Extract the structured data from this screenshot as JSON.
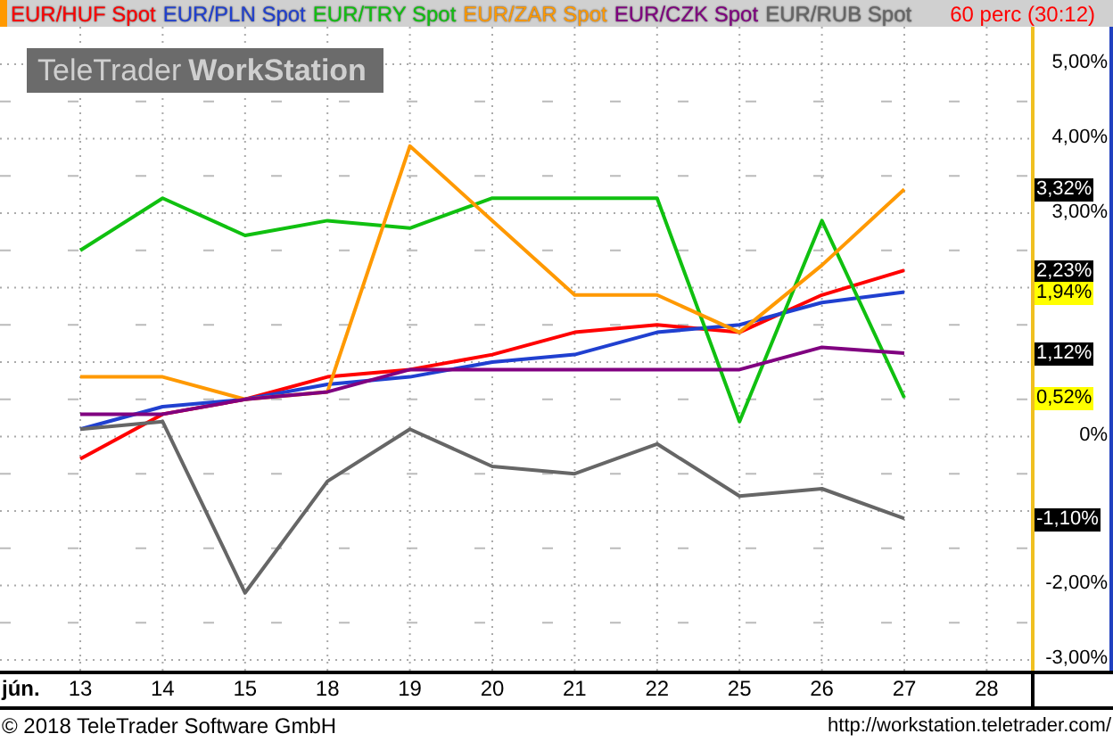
{
  "header": {
    "interval": "60 perc (30:12)"
  },
  "logo": {
    "brand": "TeleTrader",
    "product": "WorkStation"
  },
  "chart_data": {
    "type": "line",
    "categories": [
      "13",
      "14",
      "15",
      "18",
      "19",
      "20",
      "21",
      "22",
      "25",
      "26",
      "27",
      "28"
    ],
    "xlabel": "jún.",
    "grid": true,
    "ylim": [
      -3,
      5
    ],
    "yticks": [
      {
        "value": 5,
        "label": "5,00%"
      },
      {
        "value": 4,
        "label": "4,00%"
      },
      {
        "value": 3,
        "label": "3,00%"
      },
      {
        "value": 0,
        "label": "0%"
      },
      {
        "value": -2,
        "label": "-2,00%"
      },
      {
        "value": -3,
        "label": "-3,00%"
      }
    ],
    "series": [
      {
        "name": "EUR/HUF Spot",
        "color": "#ff0000",
        "values": [
          -0.3,
          0.3,
          0.5,
          0.8,
          0.9,
          1.1,
          1.4,
          1.5,
          1.4,
          1.9,
          2.23,
          null
        ]
      },
      {
        "name": "EUR/PLN Spot",
        "color": "#2040d0",
        "values": [
          0.1,
          0.4,
          0.5,
          0.7,
          0.8,
          1.0,
          1.1,
          1.4,
          1.5,
          1.8,
          1.94,
          null
        ]
      },
      {
        "name": "EUR/TRY Spot",
        "color": "#10c010",
        "values": [
          2.5,
          3.2,
          2.7,
          2.9,
          2.8,
          3.2,
          3.2,
          3.2,
          0.2,
          2.9,
          0.52,
          null
        ]
      },
      {
        "name": "EUR/ZAR Spot",
        "color": "#ff9900",
        "values": [
          0.8,
          0.8,
          0.5,
          0.6,
          3.9,
          2.9,
          1.9,
          1.9,
          1.4,
          2.3,
          3.32,
          null
        ]
      },
      {
        "name": "EUR/CZK Spot",
        "color": "#800080",
        "values": [
          0.3,
          0.3,
          0.5,
          0.6,
          0.9,
          0.9,
          0.9,
          0.9,
          0.9,
          1.2,
          1.12,
          null
        ]
      },
      {
        "name": "EUR/RUB Spot",
        "color": "#666666",
        "values": [
          0.1,
          0.2,
          -2.1,
          -0.6,
          0.1,
          -0.4,
          -0.5,
          -0.1,
          -0.8,
          -0.7,
          -1.1,
          null
        ]
      }
    ]
  },
  "last_value_badges": [
    {
      "text": "3,32%",
      "kind": "dark"
    },
    {
      "text": "2,23%",
      "kind": "dark"
    },
    {
      "text": "1,94%",
      "kind": "yellow"
    },
    {
      "text": "1,12%",
      "kind": "dark"
    },
    {
      "text": "0,52%",
      "kind": "yellow"
    },
    {
      "text": "-1,10%",
      "kind": "dark"
    }
  ],
  "footer": {
    "copyright": "© 2018 TeleTrader Software GmbH",
    "url": "http://workstation.teletrader.com/"
  }
}
